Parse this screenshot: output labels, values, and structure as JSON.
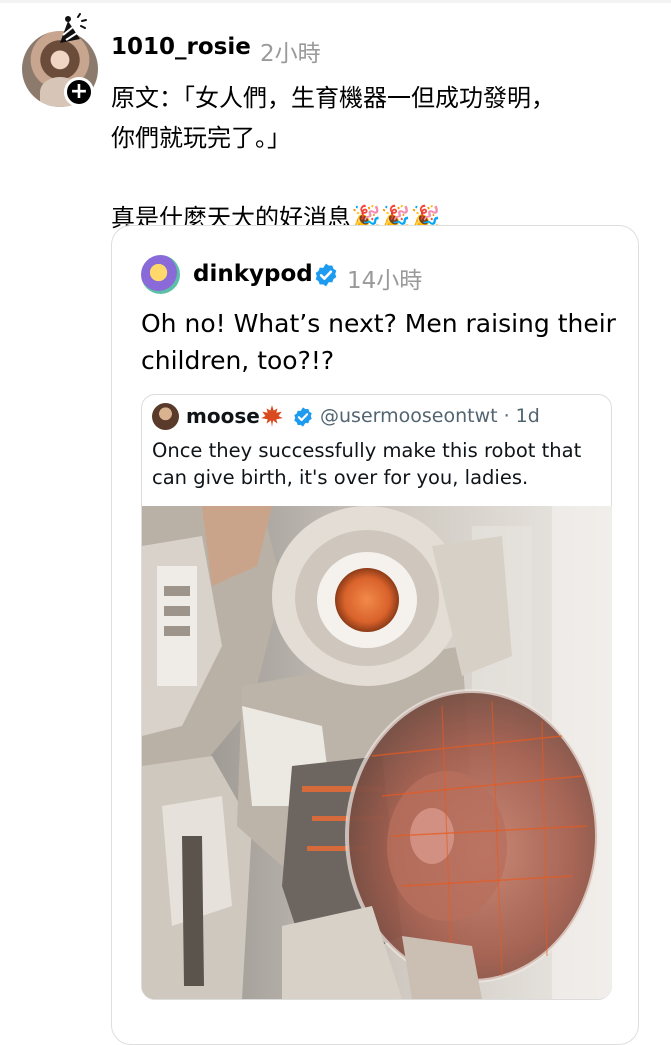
{
  "post": {
    "username": "1010_rosie",
    "time": "2小時",
    "text": "原文：「女人們，生育機器一但成功發明，\n你們就玩完了。」\n\n真是什麼天大的好消息🎉🎉🎉"
  },
  "quoted_post": {
    "username": "dinkypod",
    "time": "14小時",
    "text": "Oh no! What’s next? Men raising their children, too?!?"
  },
  "nested_tweet": {
    "name": "moose",
    "handle": "@usermooseontwt · 1d",
    "text": "Once they successfully make this robot that can give birth, it's over for you, ladies."
  },
  "icons": {
    "follow": "plus-icon",
    "verified": "verified-badge-icon",
    "moose_emoji": "maple-leaf-icon",
    "avatar_decoration": "party-hat-icon"
  },
  "colors": {
    "secondary_text": "#9a9a9a",
    "verified_blue": "#1d9bf0",
    "card_border": "#dedede"
  }
}
